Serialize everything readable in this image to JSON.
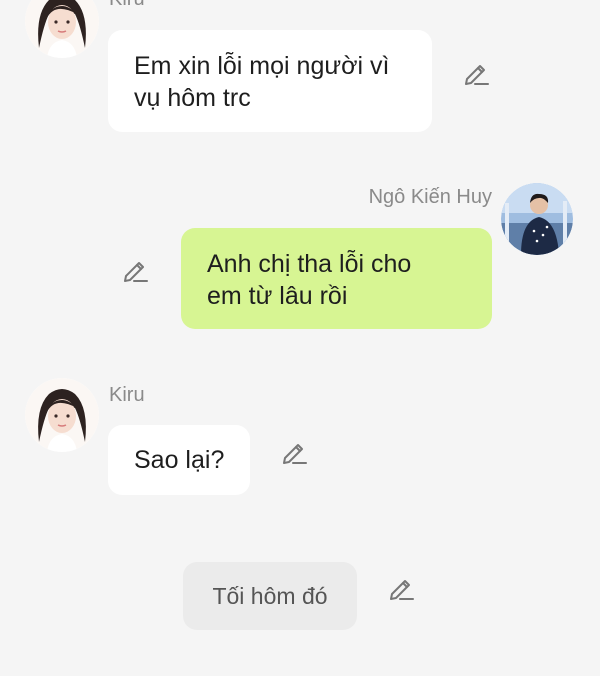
{
  "messages": [
    {
      "sender": "Kiru",
      "side": "left",
      "lines": [
        "Em xin lỗi mọi người vì",
        "vụ hôm trc"
      ]
    },
    {
      "sender": "Ngô Kiến Huy",
      "side": "right",
      "lines": [
        "Anh chị tha lỗi cho",
        "em từ lâu rồi"
      ]
    },
    {
      "sender": "Kiru",
      "side": "left",
      "lines": [
        "Sao lại?"
      ]
    }
  ],
  "draft_option": {
    "text": "Tối hôm đó"
  },
  "icons": {
    "edit": "pencil-edit-icon",
    "avatar_kiru": "anime-girl-avatar",
    "avatar_huy": "photo-avatar"
  },
  "colors": {
    "background": "#f5f5f5",
    "bubble_left": "#ffffff",
    "bubble_right": "#d7f593",
    "option_bubble": "#ebebeb",
    "name_text": "#8a8a8a"
  }
}
